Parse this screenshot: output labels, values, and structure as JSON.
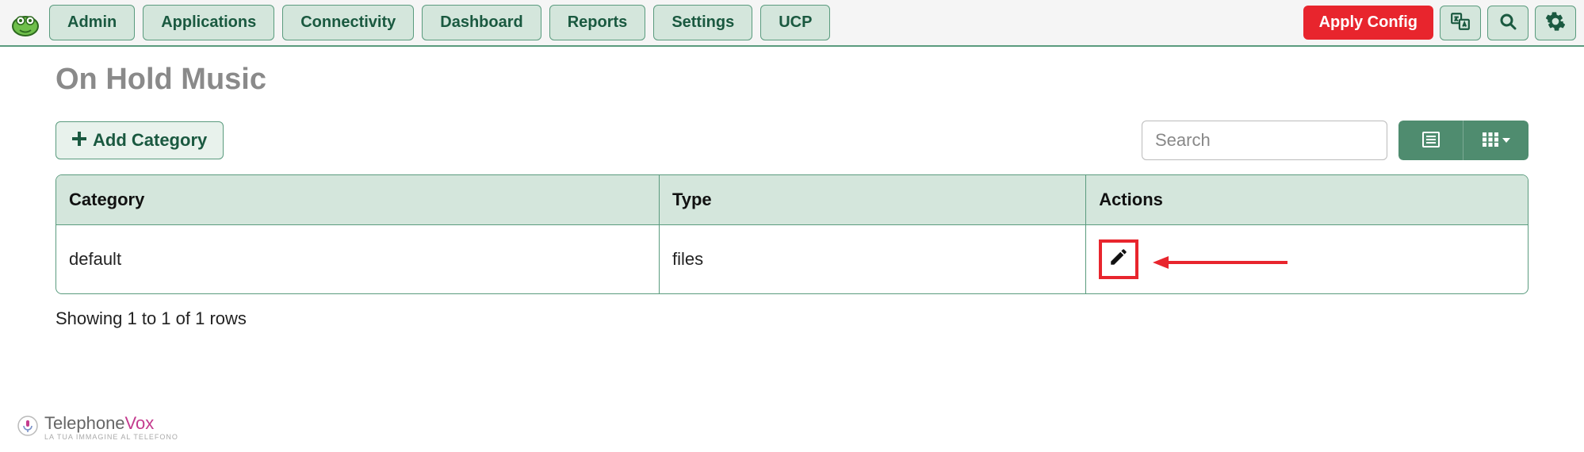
{
  "nav": {
    "items": [
      "Admin",
      "Applications",
      "Connectivity",
      "Dashboard",
      "Reports",
      "Settings",
      "UCP"
    ],
    "apply_label": "Apply Config"
  },
  "page": {
    "title": "On Hold Music",
    "add_category_label": "Add Category",
    "search_placeholder": "Search"
  },
  "table": {
    "headers": {
      "category": "Category",
      "type": "Type",
      "actions": "Actions"
    },
    "rows": [
      {
        "category": "default",
        "type": "files"
      }
    ],
    "pager_info": "Showing 1 to 1 of 1 rows"
  },
  "footer": {
    "brand_main": "Telephone",
    "brand_accent": "Vox",
    "tagline": "LA TUA IMMAGINE AL TELEFONO"
  }
}
